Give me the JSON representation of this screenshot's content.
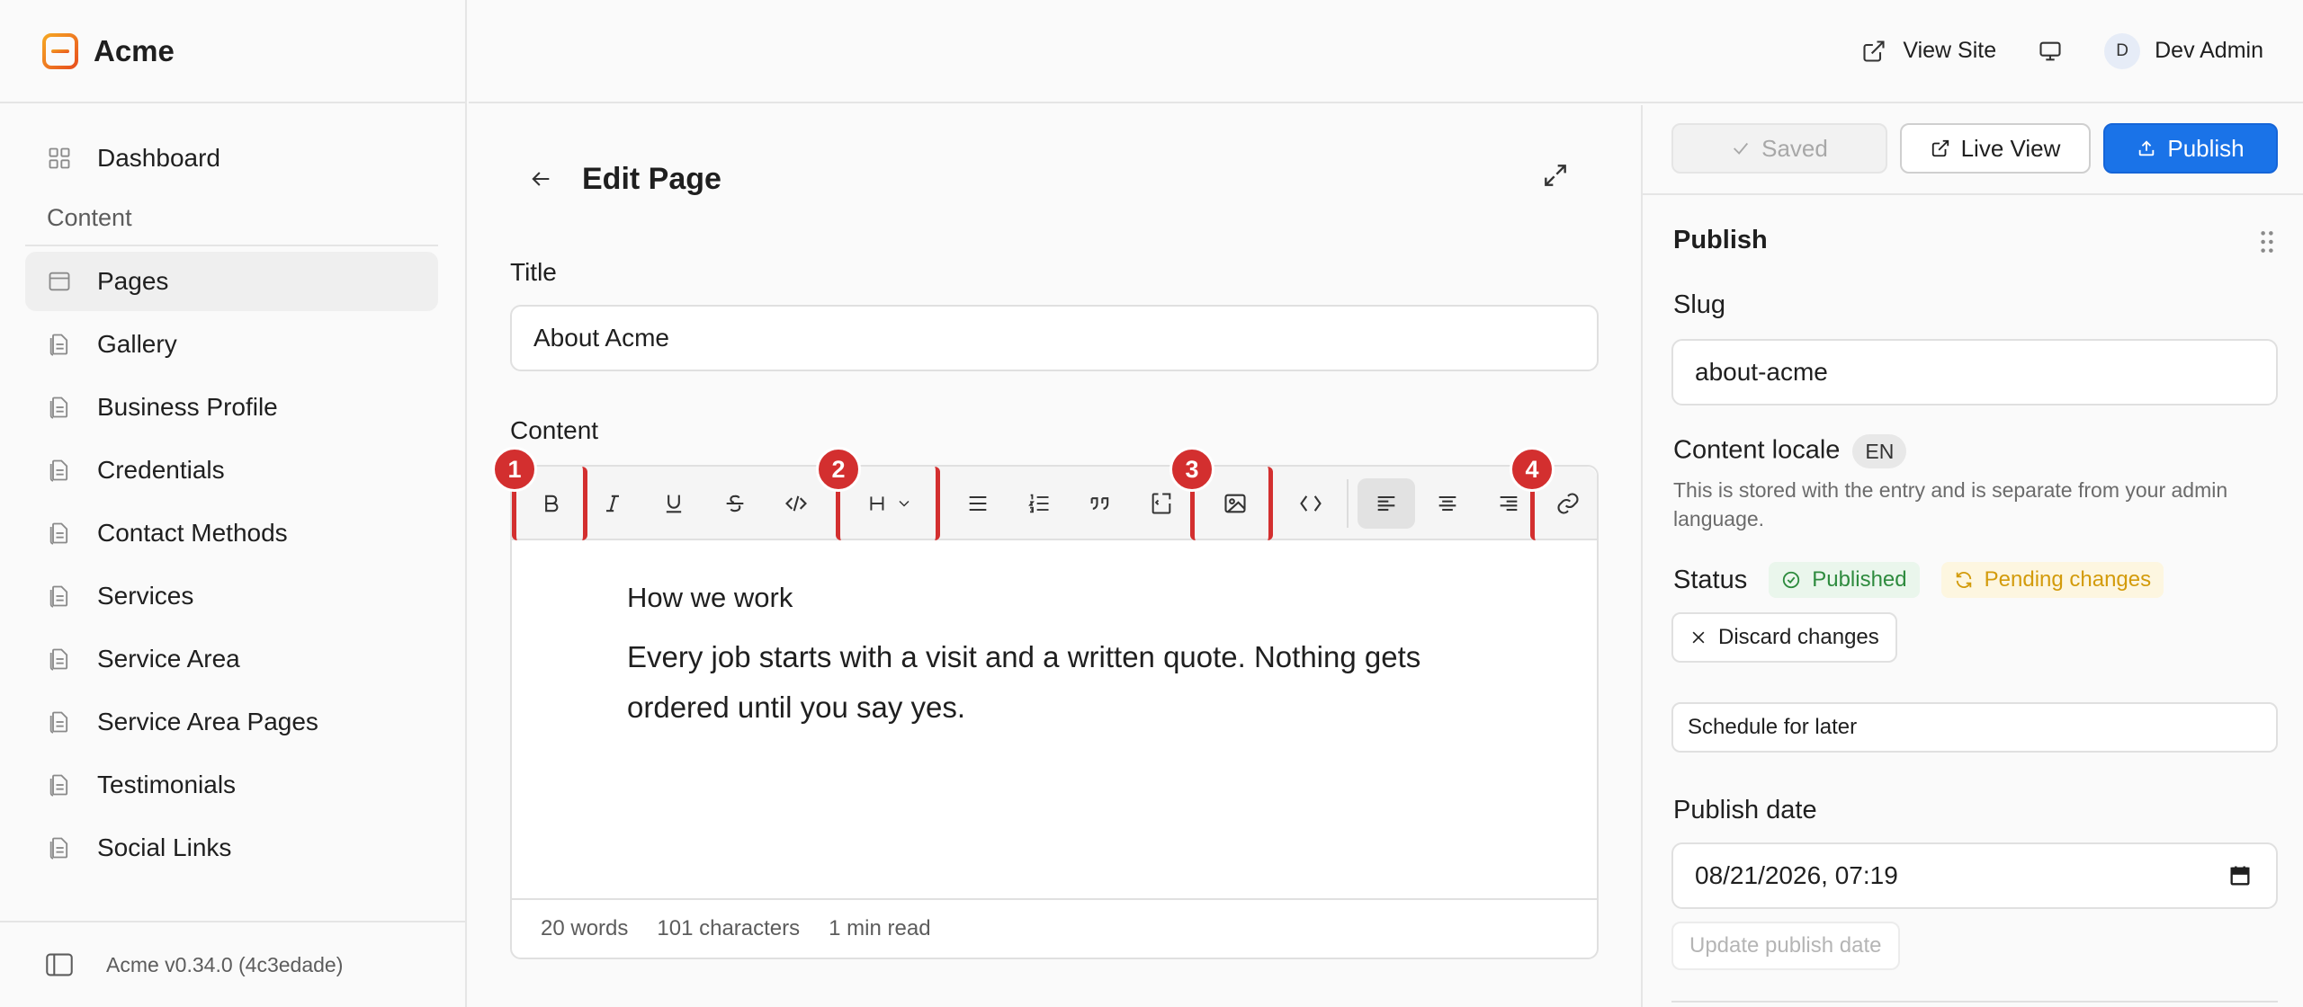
{
  "app": {
    "name": "Acme",
    "version": "Acme v0.34.0 (4c3edade)"
  },
  "topbar": {
    "view_site": "View Site",
    "user_initial": "D",
    "user_name": "Dev Admin"
  },
  "sidebar": {
    "dashboard": "Dashboard",
    "section_label": "Content",
    "items": [
      {
        "label": "Pages",
        "active": true
      },
      {
        "label": "Gallery"
      },
      {
        "label": "Business Profile"
      },
      {
        "label": "Credentials"
      },
      {
        "label": "Contact Methods"
      },
      {
        "label": "Services"
      },
      {
        "label": "Service Area"
      },
      {
        "label": "Service Area Pages"
      },
      {
        "label": "Testimonials"
      },
      {
        "label": "Social Links"
      }
    ]
  },
  "editor": {
    "page_title": "Edit Page",
    "title_label": "Title",
    "title_value": "About Acme",
    "content_label": "Content",
    "annotations": [
      "1",
      "2",
      "3",
      "4"
    ],
    "body_heading": "How we work",
    "body_paragraph": "Every job starts with a visit and a written quote. Nothing gets ordered until you say yes.",
    "stats": {
      "words": "20 words",
      "characters": "101 characters",
      "read_time": "1 min read"
    }
  },
  "panel": {
    "saved": "Saved",
    "live_view": "Live View",
    "publish": "Publish",
    "section_title": "Publish",
    "slug_label": "Slug",
    "slug_value": "about-acme",
    "locale_label": "Content locale",
    "locale_value": "EN",
    "locale_help": "This is stored with the entry and is separate from your admin language.",
    "status_label": "Status",
    "status_published": "Published",
    "status_pending": "Pending changes",
    "discard": "Discard changes",
    "schedule": "Schedule for later",
    "publish_date_label": "Publish date",
    "publish_date_value": "08/21/2026, 07:19",
    "update_date": "Update publish date"
  },
  "colors": {
    "accent": "#1a73e8",
    "annotation": "#d32f2f",
    "brand": "#f28c28",
    "published": "#2e8b3e",
    "pending": "#d39b0b"
  }
}
